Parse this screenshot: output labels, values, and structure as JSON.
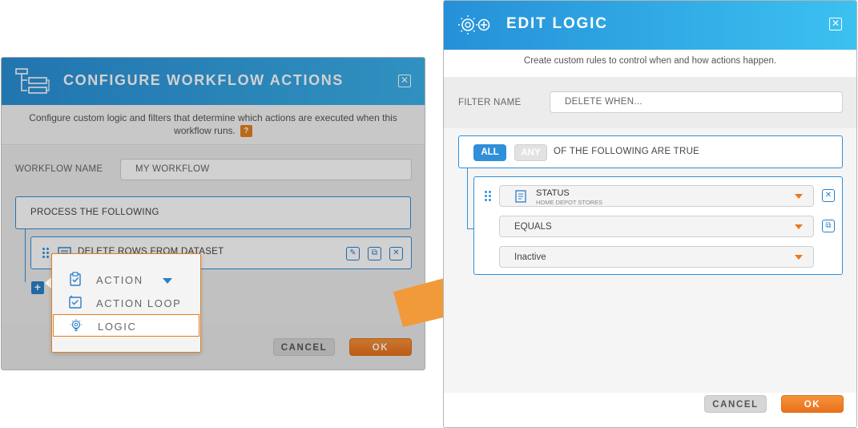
{
  "colors": {
    "accent_blue": "#2f8fd8",
    "header_blue_start": "#2590d8",
    "header_blue_end": "#3cc1f0",
    "accent_orange": "#e8781e",
    "cancel_gray": "#d6d6d6"
  },
  "configure_dialog": {
    "title": "CONFIGURE WORKFLOW ACTIONS",
    "description": "Configure custom logic and filters that determine which actions are executed when this workflow runs.",
    "help_label": "?",
    "workflow_name_label": "WORKFLOW NAME",
    "workflow_name_value": "MY WORKFLOW",
    "process_label": "PROCESS THE FOLLOWING",
    "action_row_label": "DELETE ROWS FROM DATASET",
    "add_label": "+",
    "cancel_label": "CANCEL",
    "ok_label": "OK",
    "menu": {
      "items": [
        {
          "label": "ACTION",
          "icon": "clipboard-check-icon"
        },
        {
          "label": "ACTION LOOP",
          "icon": "loop-icon"
        },
        {
          "label": "LOGIC",
          "icon": "lightbulb-gear-icon"
        }
      ]
    }
  },
  "edit_logic_dialog": {
    "title": "EDIT LOGIC",
    "description": "Create custom rules to control when and how actions happen.",
    "filter_name_label": "FILTER NAME",
    "filter_name_placeholder": "DELETE WHEN...",
    "all_label": "ALL",
    "any_label": "ANY",
    "condition_text": "OF THE FOLLOWING ARE TRUE",
    "rule": {
      "field_label": "STATUS",
      "field_sublabel": "HOME DEPOT STORES",
      "operator": "EQUALS",
      "value": "Inactive"
    },
    "cancel_label": "CANCEL",
    "ok_label": "OK"
  }
}
